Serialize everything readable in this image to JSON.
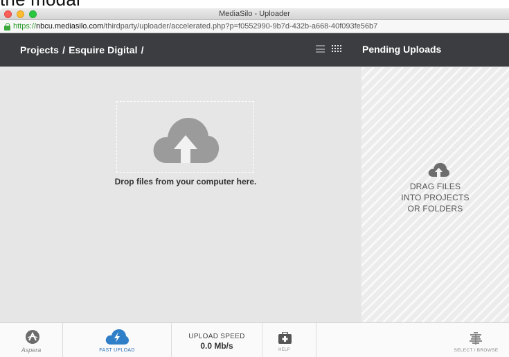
{
  "background_caption": "the modal",
  "window": {
    "title": "MediaSilo - Uploader"
  },
  "urlbar": {
    "scheme": "https://",
    "host": "nbcu.mediasilo.com",
    "path": "/thirdparty/uploader/accelerated.php?p=f0552990-9b7d-432b-a668-40f093fe56b7"
  },
  "header": {
    "breadcrumb": [
      {
        "label": "Projects"
      },
      {
        "separator": "/"
      },
      {
        "label": "Esquire Digital"
      },
      {
        "separator2": "/"
      }
    ],
    "pending_title": "Pending Uploads"
  },
  "main": {
    "drop_text": "Drop files from your computer here."
  },
  "side": {
    "lines": [
      "DRAG FILES",
      "INTO PROJECTS",
      "OR FOLDERS"
    ]
  },
  "footer": {
    "aspera_label": "Aspera",
    "fast_upload_label": "FAST UPLOAD",
    "upload_speed_label": "UPLOAD SPEED",
    "upload_speed_value": "0.0 Mb/s",
    "help_label": "HELP",
    "browse_label": "SELECT / BROWSE"
  },
  "colors": {
    "header_bg": "#3b3d40",
    "accent": "#2b6fb4",
    "ssl_green": "#2a9a2a"
  },
  "icons": {
    "lock": "lock-icon",
    "list_view": "list-view-icon",
    "grid_view": "grid-view-icon",
    "upload_cloud": "cloud-upload-icon",
    "aspera": "aspera-icon",
    "fast_upload": "fast-upload-icon",
    "help": "help-icon",
    "browse": "browse-icon"
  }
}
